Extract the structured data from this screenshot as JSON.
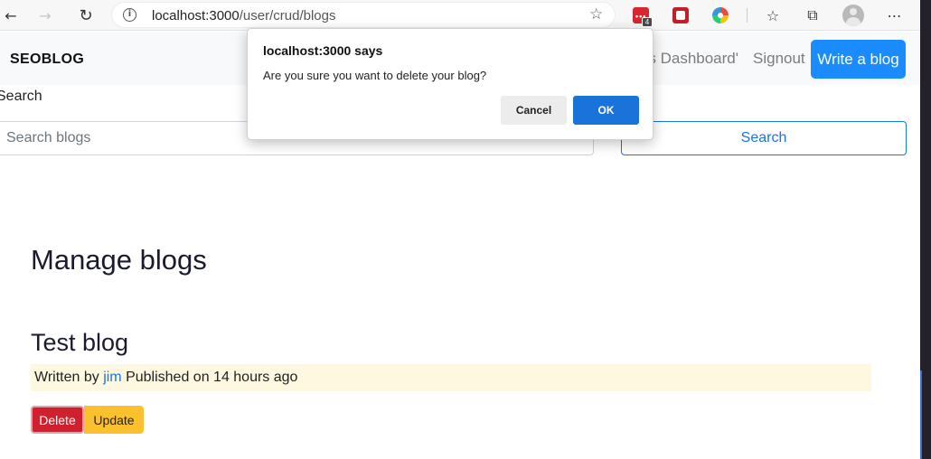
{
  "browser": {
    "url_host": "localhost:3000",
    "url_path": "/user/crud/blogs",
    "extension_badge": "4"
  },
  "navbar": {
    "brand": "SEOBLOG",
    "dashboard_label": "'s Dashboard",
    "signout_label": "Signout",
    "write_blog_label": "Write a blog"
  },
  "search": {
    "label": "Search",
    "placeholder": "Search blogs",
    "button_label": "Search"
  },
  "main": {
    "page_title": "Manage blogs",
    "blog": {
      "title": "Test blog",
      "written_by": "Written by",
      "author": "jim",
      "published": "Published on 14 hours ago",
      "delete_label": "Delete",
      "update_label": "Update"
    }
  },
  "dialog": {
    "title": "localhost:3000 says",
    "message": "Are you sure you want to delete your blog?",
    "cancel_label": "Cancel",
    "ok_label": "OK"
  },
  "icons": [
    "back-icon",
    "forward-icon",
    "reload-icon",
    "info-icon",
    "star-icon",
    "favorites-icon",
    "collections-icon",
    "profile-icon",
    "more-icon"
  ],
  "colors": {
    "primary": "#1a8cff",
    "danger": "#d0202e",
    "warning": "#fbc02d",
    "meta_bg": "#fff8e1"
  }
}
